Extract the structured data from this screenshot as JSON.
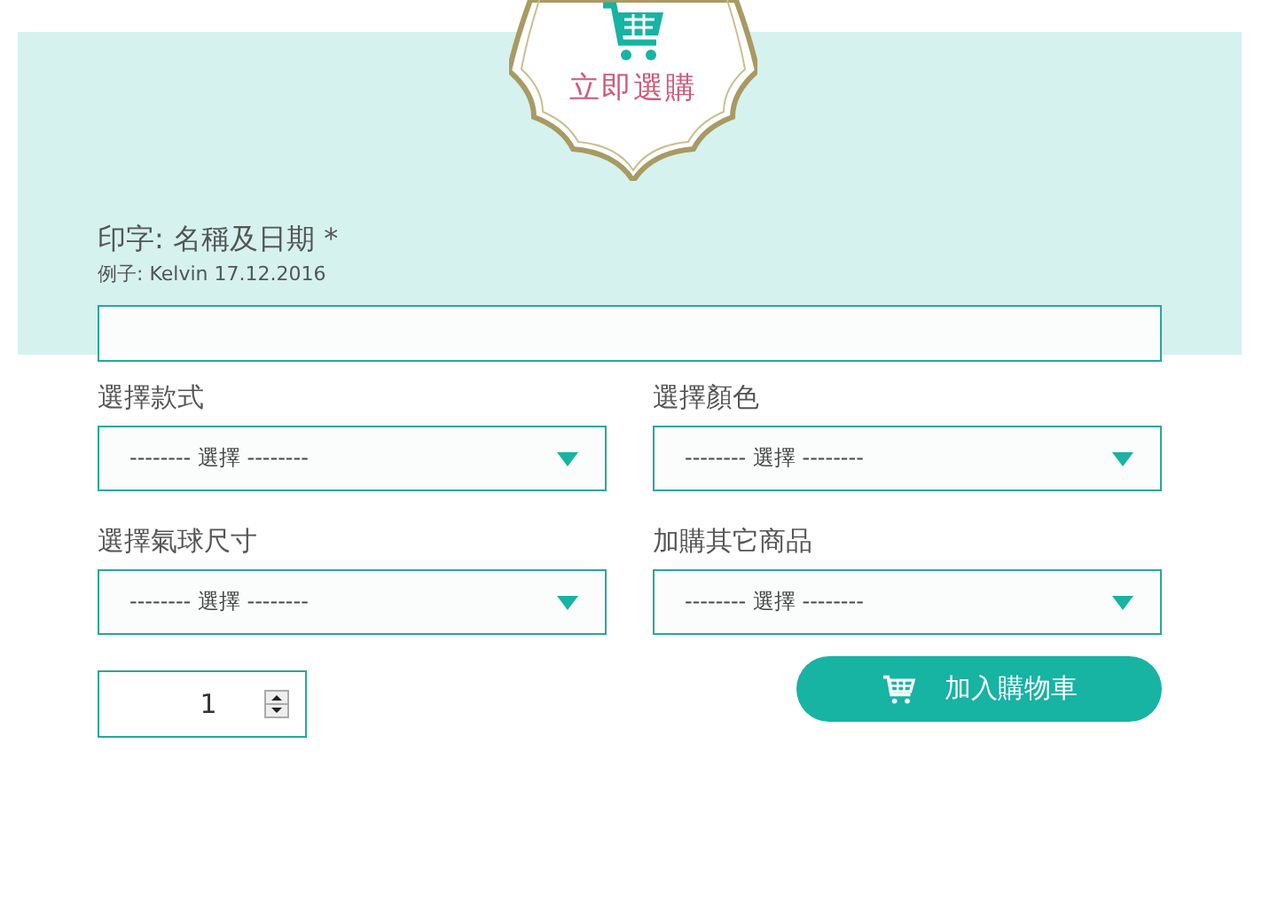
{
  "badge": {
    "title": "立即選購"
  },
  "engraving": {
    "label": "印字: 名稱及日期 *",
    "example": "例子: Kelvin 17.12.2016"
  },
  "options": [
    {
      "label": "選擇款式",
      "value": "-------- 選擇 --------"
    },
    {
      "label": "選擇顏色",
      "value": "-------- 選擇 --------"
    },
    {
      "label": "選擇氣球尺寸",
      "value": "-------- 選擇 --------"
    },
    {
      "label": "加購其它商品",
      "value": "-------- 選擇 --------"
    }
  ],
  "quantity": "1",
  "add_to_cart_button": "加入購物車"
}
